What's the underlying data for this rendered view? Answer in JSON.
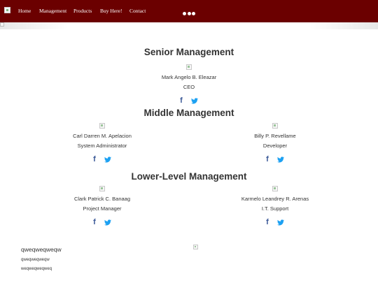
{
  "nav": {
    "items": [
      {
        "label": "Home"
      },
      {
        "label": "Management"
      },
      {
        "label": "Products"
      },
      {
        "label": "Buy Here!"
      },
      {
        "label": "Contact"
      }
    ],
    "background": "#6b0000"
  },
  "sections": {
    "senior": {
      "title": "Senior Management",
      "members": [
        {
          "name": "Mark Angelo B. Eleazar",
          "role": "CEO"
        }
      ]
    },
    "middle": {
      "title": "Middle Management",
      "members": [
        {
          "name": "Carl Darren M. Apelacion",
          "role": "System Administrator"
        },
        {
          "name": "Billy P. Revellame",
          "role": "Developer"
        }
      ]
    },
    "lower": {
      "title": "Lower-Level Management",
      "members": [
        {
          "name": "Clark Patrick C. Banaag",
          "role": "Project Manager"
        },
        {
          "name": "Karmelo Leandrey R. Arenas",
          "role": "I.T. Support"
        }
      ]
    }
  },
  "social_icons": [
    "facebook-icon",
    "twitter-icon"
  ],
  "colors": {
    "facebook": "#3b5998",
    "twitter": "#1da1f2"
  },
  "footer": {
    "heading": "qweqweqweqw",
    "lines": [
      "qweqweqweqw",
      "weqweqweqweq"
    ]
  }
}
